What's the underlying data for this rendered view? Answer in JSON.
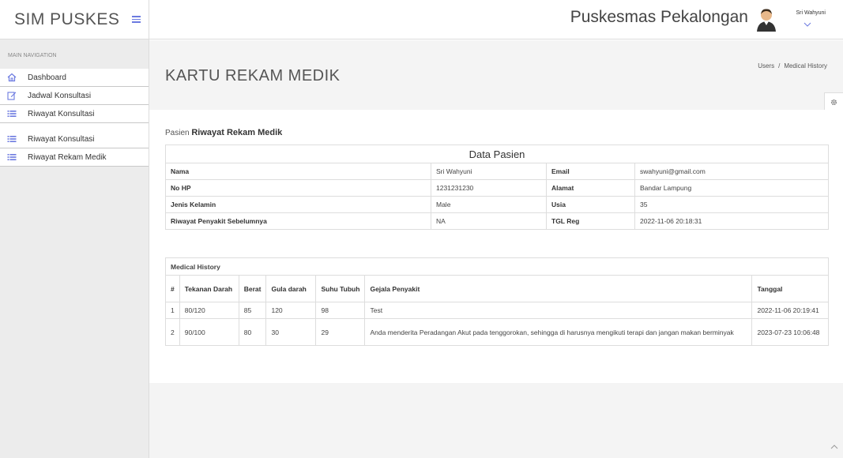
{
  "brand": {
    "name": "SIM PUSKES"
  },
  "sidebar": {
    "header": "MAIN NAVIGATION",
    "items": [
      {
        "label": "Dashboard",
        "icon": "home-icon"
      },
      {
        "label": "Jadwal Konsultasi",
        "icon": "edit-icon"
      },
      {
        "label": "Riwayat Konsultasi",
        "icon": "list-icon"
      },
      {
        "label": "Riwayat Konsultasi",
        "icon": "list-icon"
      },
      {
        "label": "Riwayat Rekam Medik",
        "icon": "list-icon"
      }
    ]
  },
  "topbar": {
    "site_name": "Puskesmas Pekalongan",
    "user_name": "Sri Wahyuni"
  },
  "page": {
    "title": "KARTU REKAM MEDIK",
    "breadcrumb": [
      "Users",
      "Medical History"
    ],
    "section_prefix": "Pasien",
    "section_title": "Riwayat Rekam Medik"
  },
  "patient": {
    "title": "Data Pasien",
    "rows": [
      {
        "l1": "Nama",
        "v1": "Sri Wahyuni",
        "l2": "Email",
        "v2": "swahyuni@gmail.com"
      },
      {
        "l1": "No HP",
        "v1": "1231231230",
        "l2": "Alamat",
        "v2": "Bandar Lampung"
      },
      {
        "l1": "Jenis Kelamin",
        "v1": "Male",
        "l2": "Usia",
        "v2": "35"
      },
      {
        "l1": "Riwayat Penyakit Sebelumnya",
        "v1": "NA",
        "l2": "TGL Reg",
        "v2": "2022-11-06 20:18:31"
      }
    ]
  },
  "history": {
    "title": "Medical History",
    "headers": [
      "#",
      "Tekanan Darah",
      "Berat",
      "Gula darah",
      "Suhu Tubuh",
      "Gejala Penyakit",
      "Tanggal"
    ],
    "rows": [
      [
        "1",
        "80/120",
        "85",
        "120",
        "98",
        "Test",
        "2022-11-06 20:19:41"
      ],
      [
        "2",
        "90/100",
        "80",
        "30",
        "29",
        "Anda menderita Peradangan Akut pada tenggorokan, sehingga di harusnya mengikuti terapi dan jangan makan berminyak",
        "2023-07-23 10:06:48"
      ]
    ]
  },
  "colors": {
    "accent": "#6c7ae0",
    "sidebar_bg": "#ececec",
    "content_bg": "#f4f4f4"
  }
}
